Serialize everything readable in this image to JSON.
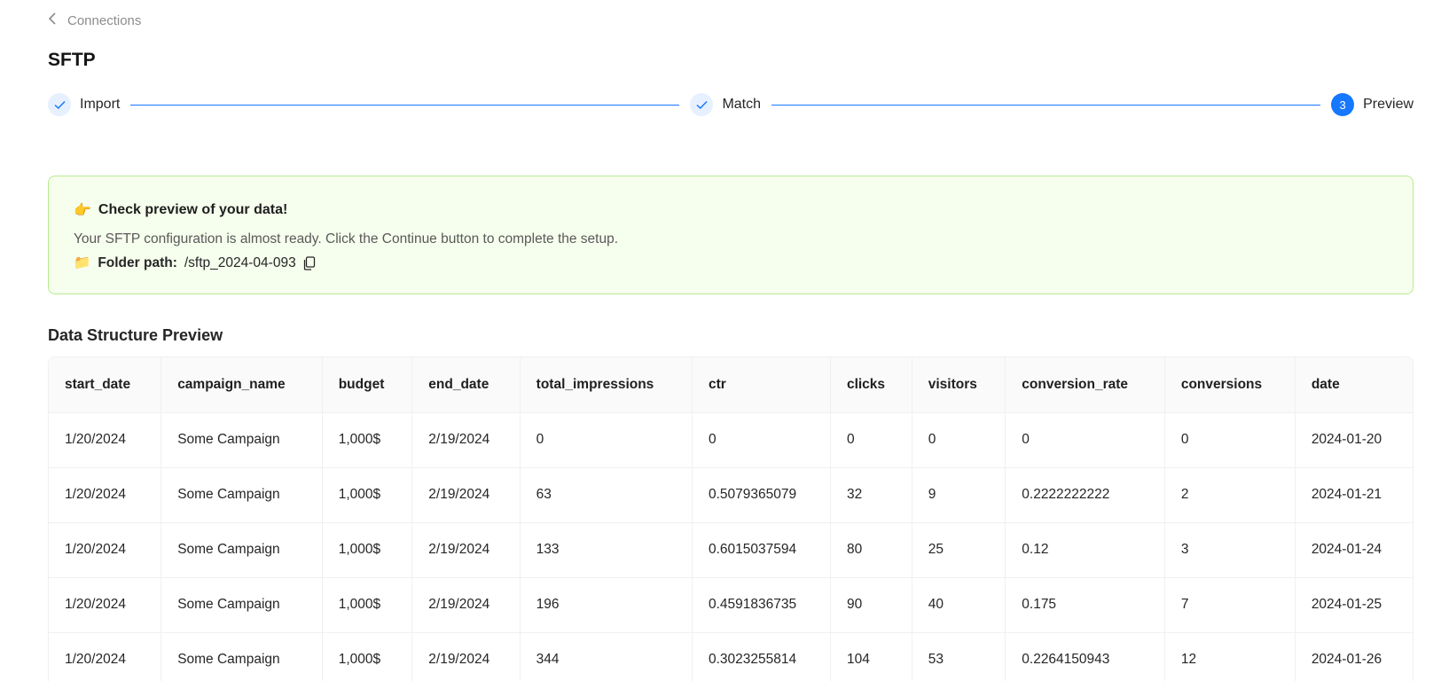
{
  "nav": {
    "back_label": "Connections"
  },
  "page": {
    "title": "SFTP"
  },
  "steps": [
    {
      "label": "Import",
      "status": "done",
      "icon": "check-icon"
    },
    {
      "label": "Match",
      "status": "done",
      "icon": "check-icon"
    },
    {
      "label": "Preview",
      "status": "active",
      "number": "3"
    }
  ],
  "alert": {
    "emoji": "👉",
    "title": "Check preview of your data!",
    "description": "Your SFTP configuration is almost ready. Click the Continue button to complete the setup.",
    "folder_emoji": "📁",
    "folder_label": "Folder path:",
    "folder_path": "/sftp_2024-04-093"
  },
  "preview": {
    "title": "Data Structure Preview",
    "columns": [
      "start_date",
      "campaign_name",
      "budget",
      "end_date",
      "total_impressions",
      "ctr",
      "clicks",
      "visitors",
      "conversion_rate",
      "conversions",
      "date"
    ],
    "rows": [
      [
        "1/20/2024",
        "Some Campaign",
        "1,000$",
        "2/19/2024",
        "0",
        "0",
        "0",
        "0",
        "0",
        "0",
        "2024-01-20"
      ],
      [
        "1/20/2024",
        "Some Campaign",
        "1,000$",
        "2/19/2024",
        "63",
        "0.5079365079",
        "32",
        "9",
        "0.2222222222",
        "2",
        "2024-01-21"
      ],
      [
        "1/20/2024",
        "Some Campaign",
        "1,000$",
        "2/19/2024",
        "133",
        "0.6015037594",
        "80",
        "25",
        "0.12",
        "3",
        "2024-01-24"
      ],
      [
        "1/20/2024",
        "Some Campaign",
        "1,000$",
        "2/19/2024",
        "196",
        "0.4591836735",
        "90",
        "40",
        "0.175",
        "7",
        "2024-01-25"
      ],
      [
        "1/20/2024",
        "Some Campaign",
        "1,000$",
        "2/19/2024",
        "344",
        "0.3023255814",
        "104",
        "53",
        "0.2264150943",
        "12",
        "2024-01-26"
      ]
    ]
  },
  "colors": {
    "accent": "#1677ff",
    "alert_bg": "#f6ffed",
    "alert_border": "#b7eb8f"
  }
}
